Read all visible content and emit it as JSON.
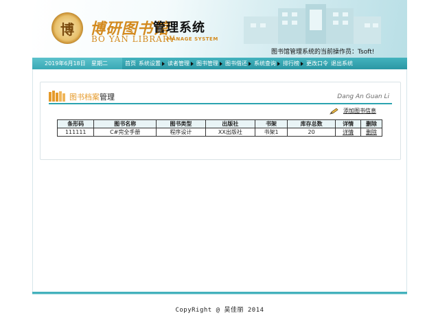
{
  "header": {
    "logo_seal_char": "博",
    "logo_cn": "博研图书馆",
    "logo_system": "管理系统",
    "logo_en": "BO YAN LIBRARY",
    "logo_en_sub": "MANAGE SYSTEM",
    "operator_text": "图书馆管理系统的当前操作员：Tsoft!"
  },
  "nav": {
    "date": "2019年6月18日",
    "weekday": "星期二",
    "items": [
      {
        "label": "首页",
        "arrow": false
      },
      {
        "label": "系统设置",
        "arrow": true
      },
      {
        "label": "读者管理",
        "arrow": true
      },
      {
        "label": "图书管理",
        "arrow": true
      },
      {
        "label": "图书借还",
        "arrow": true
      },
      {
        "label": "系统查询",
        "arrow": true
      },
      {
        "label": "排行榜",
        "arrow": true
      },
      {
        "label": "更改口令",
        "arrow": false
      },
      {
        "label": "退出系统",
        "arrow": false
      }
    ]
  },
  "panel": {
    "title_highlight": "图书档案",
    "title_rest": "管理",
    "title_pinyin": "Dang An Guan Li",
    "add_link": "添加图书信息"
  },
  "table": {
    "headers": [
      "条形码",
      "图书名称",
      "图书类型",
      "出版社",
      "书架",
      "库存总数",
      "详情",
      "删除"
    ],
    "rows": [
      [
        "111111",
        "C#完全手册",
        "程序设计",
        "XX出版社",
        "书架1",
        "20",
        "详情",
        "删除"
      ]
    ]
  },
  "footer": {
    "copyright": "CopyRight @ 吴佳丽 2014"
  },
  "colors": {
    "accent": "#3aa9b5",
    "title_orange": "#e59a2a",
    "logo_gold": "#d38a1e"
  }
}
